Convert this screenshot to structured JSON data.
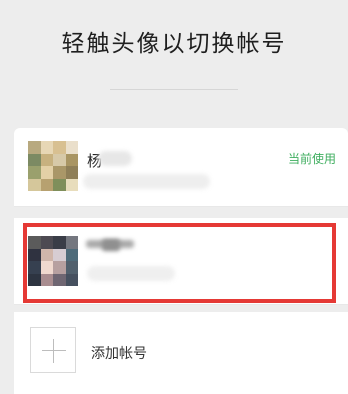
{
  "header": {
    "title": "轻触头像以切换帐号"
  },
  "accounts": [
    {
      "name_visible": "杨",
      "status": "当前使用",
      "avatar_desc": "blurred-avatar"
    },
    {
      "name_visible": "",
      "avatar_desc": "blurred-avatar"
    }
  ],
  "add_account": {
    "label": "添加帐号"
  },
  "colors": {
    "background": "#ededed",
    "card": "#ffffff",
    "status_green": "#3fae5f",
    "highlight_red": "#e53935"
  }
}
